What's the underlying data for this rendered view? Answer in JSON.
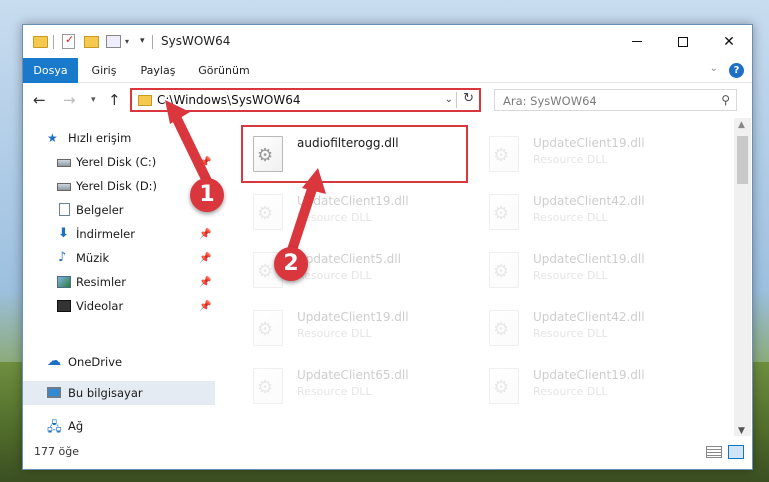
{
  "window": {
    "title": "SysWOW64",
    "controls": [
      "minimize",
      "maximize",
      "close"
    ]
  },
  "ribbon": {
    "tabs": [
      {
        "label": "Dosya",
        "active": true
      },
      {
        "label": "Giriş"
      },
      {
        "label": "Paylaş"
      },
      {
        "label": "Görünüm"
      }
    ],
    "accent": "#1979ca"
  },
  "nav": {
    "address": "C:\\Windows\\SysWOW64",
    "search_placeholder": "Ara: SysWOW64"
  },
  "sidebar": {
    "items": [
      {
        "label": "Hızlı erişim",
        "icon": "star-icon"
      },
      {
        "label": "Yerel Disk (C:)",
        "icon": "drive-icon",
        "pinned": true
      },
      {
        "label": "Yerel Disk (D:)",
        "icon": "drive-icon"
      },
      {
        "label": "Belgeler",
        "icon": "document-icon"
      },
      {
        "label": "İndirmeler",
        "icon": "download-icon",
        "pinned": true
      },
      {
        "label": "Müzik",
        "icon": "music-icon",
        "pinned": true
      },
      {
        "label": "Resimler",
        "icon": "picture-icon",
        "pinned": true
      },
      {
        "label": "Videolar",
        "icon": "video-icon",
        "pinned": true
      },
      {
        "label": "OneDrive",
        "icon": "cloud-icon"
      },
      {
        "label": "Bu bilgisayar",
        "icon": "computer-icon",
        "selected": true
      },
      {
        "label": "Ağ",
        "icon": "network-icon"
      }
    ]
  },
  "files": [
    {
      "name": "audiofilterogg.dll",
      "type": ""
    },
    {
      "name": "UpdateClient19.dll",
      "type": "Resource DLL"
    },
    {
      "name": "UpdateClient19.dll",
      "type": "Resource DLL"
    },
    {
      "name": "UpdateClient42.dll",
      "type": "Resource DLL"
    },
    {
      "name": "UpdateClient5.dll",
      "type": "Resource DLL"
    },
    {
      "name": "UpdateClient19.dll",
      "type": "Resource DLL"
    },
    {
      "name": "UpdateClient19.dll",
      "type": "Resource DLL"
    },
    {
      "name": "UpdateClient42.dll",
      "type": "Resource DLL"
    },
    {
      "name": "UpdateClient65.dll",
      "type": "Resource DLL"
    },
    {
      "name": "UpdateClient19.dll",
      "type": "Resource DLL"
    }
  ],
  "status": {
    "item_count": "177 öğe"
  },
  "annotations": {
    "callout_1": "1",
    "callout_2": "2",
    "color": "#d9363e"
  }
}
